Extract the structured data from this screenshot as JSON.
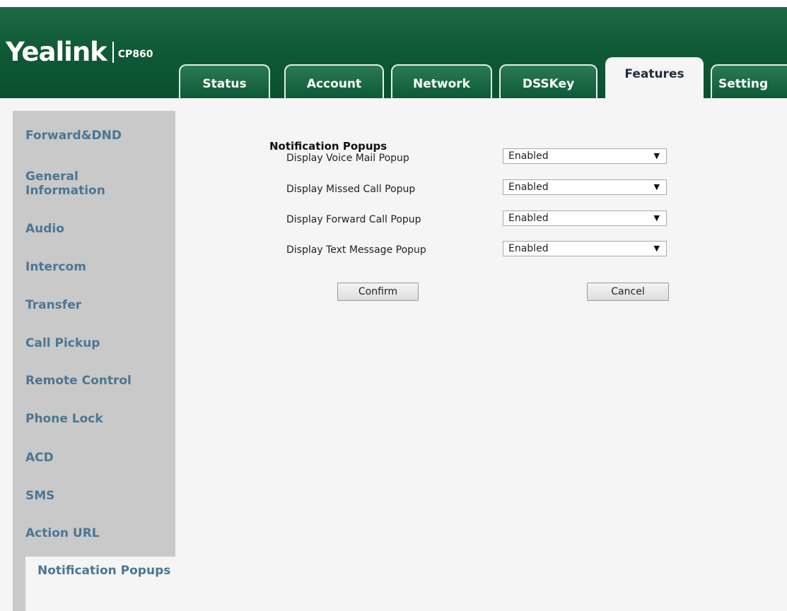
{
  "brand": {
    "name": "Yealink",
    "model": "CP860"
  },
  "tabs": [
    {
      "label": "Status"
    },
    {
      "label": "Account"
    },
    {
      "label": "Network"
    },
    {
      "label": "DSSKey"
    },
    {
      "label": "Features"
    },
    {
      "label": "Setting"
    }
  ],
  "active_tab": "Features",
  "sidebar": {
    "items": [
      {
        "label": "Forward&DND"
      },
      {
        "label": "General Information"
      },
      {
        "label": "Audio"
      },
      {
        "label": "Intercom"
      },
      {
        "label": "Transfer"
      },
      {
        "label": "Call Pickup"
      },
      {
        "label": "Remote Control"
      },
      {
        "label": "Phone Lock"
      },
      {
        "label": "ACD"
      },
      {
        "label": "SMS"
      },
      {
        "label": "Action URL"
      },
      {
        "label": "Notification Popups"
      }
    ],
    "active": "Notification Popups"
  },
  "main": {
    "section_title": "Notification Popups",
    "rows": [
      {
        "label": "Display Voice Mail Popup",
        "value": "Enabled"
      },
      {
        "label": "Display Missed Call Popup",
        "value": "Enabled"
      },
      {
        "label": "Display Forward Call Popup",
        "value": "Enabled"
      },
      {
        "label": "Display Text Message Popup",
        "value": "Enabled"
      }
    ],
    "confirm_label": "Confirm",
    "cancel_label": "Cancel"
  },
  "icons": {
    "dropdown": "chevron-down-icon"
  },
  "colors": {
    "header_green": "#0f5a37",
    "nav_text": "#4b7694",
    "sidebar_bg": "#c9c9c9"
  }
}
